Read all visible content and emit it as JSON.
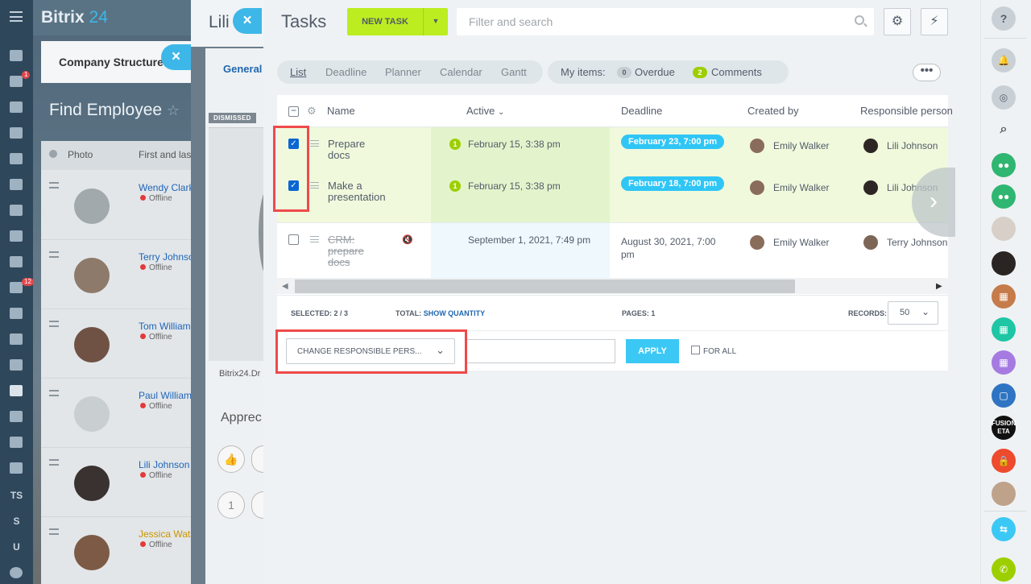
{
  "background_app": {
    "logo_main": "Bitrix",
    "logo_num": "24",
    "company_structure": "Company Structure",
    "find_employee": "Find Employee",
    "col_photo": "Photo",
    "col_name": "First and las",
    "employees": [
      {
        "name": "Wendy Clark",
        "status": "Offline"
      },
      {
        "name": "Terry Johnso",
        "status": "Offline"
      },
      {
        "name": "Tom Williams",
        "status": "Offline"
      },
      {
        "name": "Paul William",
        "status": "Offline"
      },
      {
        "name": "Lili Johnson",
        "status": "Offline"
      },
      {
        "name": "Jessica Wats",
        "status": "Offline"
      }
    ],
    "left_badges": {
      "messages": "1",
      "tasks": "12"
    },
    "left_texts": [
      "TS",
      "S",
      "U"
    ]
  },
  "profile_panel": {
    "title": "Lili",
    "tab": "General",
    "dismissed": "DISMISSED",
    "domain": "Bitrix24.Dr",
    "appreciation": "Apprec",
    "counter": "1"
  },
  "tasks": {
    "title": "Tasks",
    "new_task": "NEW TASK",
    "search_placeholder": "Filter and search",
    "views": [
      "List",
      "Deadline",
      "Planner",
      "Calendar",
      "Gantt"
    ],
    "my_items_label": "My items:",
    "overdue_count": "0",
    "overdue_label": "Overdue",
    "comments_count": "2",
    "comments_label": "Comments",
    "more": "•••",
    "columns": {
      "name": "Name",
      "active": "Active",
      "deadline": "Deadline",
      "created_by": "Created by",
      "responsible": "Responsible person"
    },
    "rows": [
      {
        "name_line1": "Prepare",
        "name_line2": "docs",
        "active_count": "1",
        "active": "February 15, 3:38 pm",
        "deadline": "February 23, 7:00 pm",
        "created_by": "Emily Walker",
        "responsible": "Lili Johnson",
        "checked": true
      },
      {
        "name_line1": "Make a",
        "name_line2": "presentation",
        "active_count": "1",
        "active": "February 15, 3:38 pm",
        "deadline": "February 18, 7:00 pm",
        "created_by": "Emily Walker",
        "responsible": "Lili Johnson",
        "checked": true
      },
      {
        "name_line1": "CRM:",
        "name_line2": "prepare",
        "name_line3": "docs",
        "active": "September 1, 2021, 7:49 pm",
        "deadline_line1": "August 30, 2021, 7:00",
        "deadline_line2": "pm",
        "created_by": "Emily Walker",
        "responsible": "Terry Johnson",
        "checked": false
      }
    ],
    "footer": {
      "selected_label": "SELECTED:",
      "selected_value": "2 / 3",
      "total_label": "TOTAL:",
      "show_quantity": "SHOW QUANTITY",
      "pages_label": "PAGES:",
      "pages_value": "1",
      "records_label": "RECORDS:",
      "records_value": "50"
    },
    "actions": {
      "select_value": "CHANGE RESPONSIBLE PERS...",
      "apply": "APPLY",
      "for_all": "FOR ALL"
    }
  },
  "right_bar": {
    "help": "?",
    "app_text": "FUSION ETA"
  },
  "colors": {
    "accent_green": "#bbed21",
    "accent_blue": "#3bc8f5",
    "highlight_red": "#ef4a4a",
    "row_selected": "#f0f9dc"
  }
}
